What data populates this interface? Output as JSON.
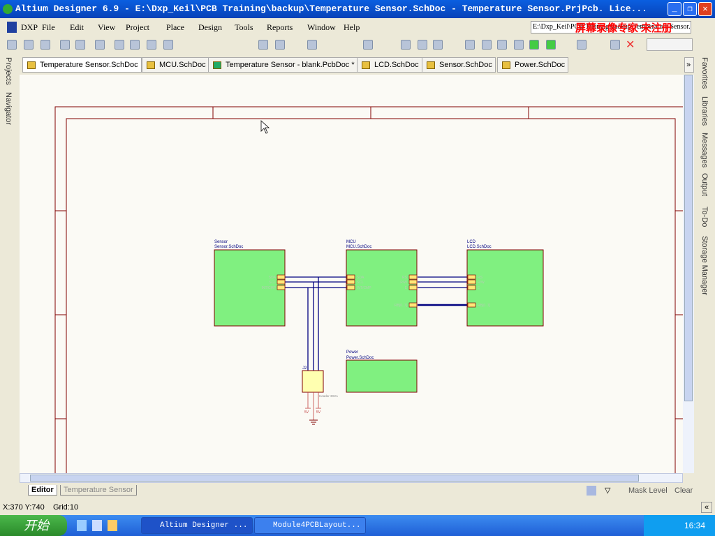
{
  "window": {
    "title": "Altium Designer 6.9 - E:\\Dxp_Keil\\PCB Training\\backup\\Temperature Sensor.SchDoc - Temperature Sensor.PrjPcb. Lice...",
    "minimize": "_",
    "restore": "❐",
    "close": "✕"
  },
  "menu": [
    "DXP",
    "File",
    "Edit",
    "View",
    "Project",
    "Place",
    "Design",
    "Tools",
    "Reports",
    "Window",
    "Help"
  ],
  "path_field": "E:\\Dxp_Keil\\PCB Training\\backup\\Temperature Sensor.SchDoc",
  "watermark": "屏幕录像专家 未注册",
  "doc_tabs": [
    {
      "label": "Temperature Sensor.SchDoc",
      "active": true
    },
    {
      "label": "MCU.SchDoc"
    },
    {
      "label": "Temperature Sensor - blank.PcbDoc *"
    },
    {
      "label": "LCD.SchDoc"
    },
    {
      "label": "Sensor.SchDoc"
    },
    {
      "label": "Power.SchDoc"
    }
  ],
  "tabs_more": "»",
  "left_panels": [
    "Projects",
    "Navigator"
  ],
  "right_panels": [
    "Favorites",
    "Libraries",
    "Messages",
    "Output",
    "To-Do",
    "Storage Manager"
  ],
  "schematic": {
    "sheets": [
      {
        "name": "Sensor",
        "file": "Sensor.SchDoc",
        "ports": [
          "SDA",
          "SCL",
          "INT/CMP"
        ]
      },
      {
        "name": "MCU",
        "file": "MCU.SchDoc",
        "ports_left": [
          "SDA",
          "SCL",
          "INT/CMP"
        ],
        "ports_right": [
          "RS",
          "R/W",
          "E",
          "RB[0..7]"
        ]
      },
      {
        "name": "LCD",
        "file": "LCD.SchDoc",
        "ports": [
          "RS",
          "R/W",
          "E",
          "RB[0..7]"
        ]
      },
      {
        "name": "Power",
        "file": "Power.SchDoc"
      }
    ],
    "connector": {
      "designator": "J2",
      "comment": "Header 3X2A",
      "power": [
        "5V",
        "5V"
      ]
    },
    "colors": {
      "sheet_fill": "#80f080",
      "sheet_border": "#800000",
      "wire": "#000080",
      "port_fill": "#ffe878",
      "title": "#000080"
    }
  },
  "bottom_tabs": [
    "Editor",
    "Temperature Sensor"
  ],
  "bottom_right": {
    "mask_level": "Mask Level",
    "clear": "Clear"
  },
  "status": {
    "coords": "X:370 Y:740",
    "grid": "Grid:10"
  },
  "taskbar": {
    "start": "开始",
    "tasks": [
      "Altium Designer ...",
      "Module4PCBLayout..."
    ],
    "clock": "16:34"
  }
}
